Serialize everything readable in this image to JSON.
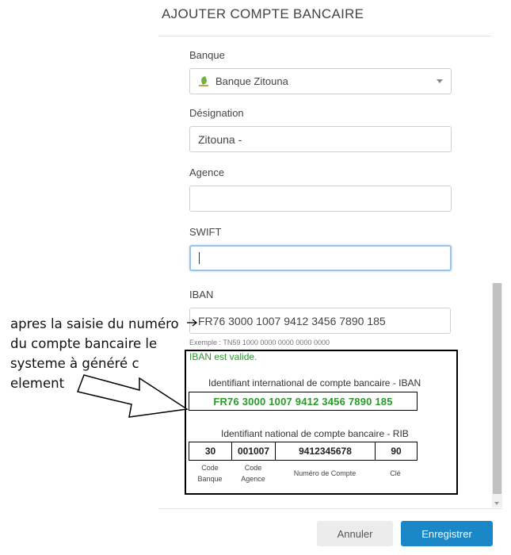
{
  "dialog": {
    "title": "AJOUTER COMPTE BANCAIRE"
  },
  "form": {
    "banque": {
      "label": "Banque",
      "value": "Banque Zitouna"
    },
    "designation": {
      "label": "Désignation",
      "value": "Zitouna -"
    },
    "agence": {
      "label": "Agence",
      "value": ""
    },
    "swift": {
      "label": "SWIFT",
      "value": ""
    },
    "iban": {
      "label": "IBAN",
      "value": "FR76 3000 1007 9412 3456 7890 185",
      "hint": "Exemple : TN59 1000 0000 0000 0000 0000",
      "status": "IBAN est valide."
    }
  },
  "iban_details": {
    "international_heading": "Identifiant international de compte bancaire - IBAN",
    "iban_value": "FR76 3000 1007 9412 3456 7890 185",
    "national_heading": "Identifiant national de compte bancaire - RIB",
    "rib": [
      {
        "value": "30",
        "caption_l1": "Code",
        "caption_l2": "Banque"
      },
      {
        "value": "001007",
        "caption_l1": "Code",
        "caption_l2": "Agence"
      },
      {
        "value": "9412345678",
        "caption_l1": "Numéro de Compte",
        "caption_l2": ""
      },
      {
        "value": "90",
        "caption_l1": "Clé",
        "caption_l2": ""
      }
    ]
  },
  "annotation": {
    "lines": [
      "apres la saisie du numéro",
      "du compte bancaire le",
      "systeme à généré c",
      "element"
    ]
  },
  "actions": {
    "cancel": "Annuler",
    "save": "Enregistrer"
  },
  "colors": {
    "primary": "#1a87c9",
    "valid": "#2a9a2a",
    "logo_leaf": "#6fb33a"
  },
  "icons": {
    "bank_logo": "zitouna-leaf-icon",
    "dropdown": "chevron-down-icon"
  }
}
